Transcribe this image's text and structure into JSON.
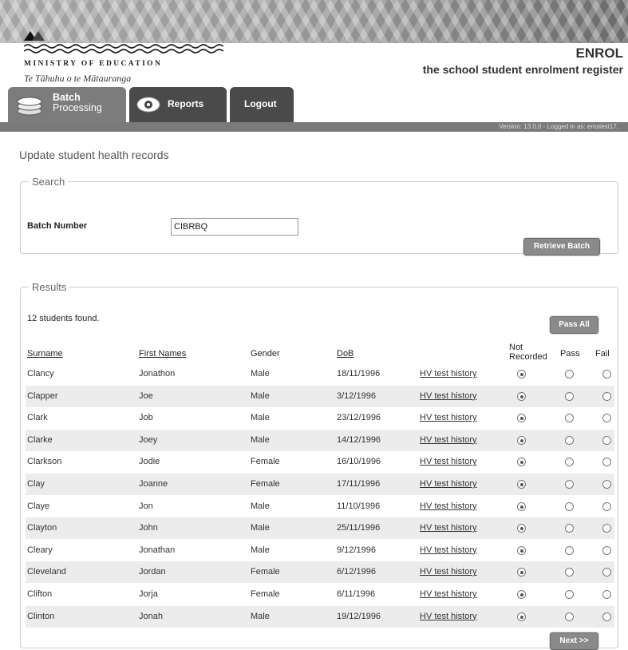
{
  "header": {
    "ministry": "MINISTRY OF EDUCATION",
    "ministry_maori": "Te Tāhuhu o te Mātauranga",
    "app_name": "ENROL",
    "app_subtitle": "the school student enrolment register",
    "version_text": "Version: 13.0.0 - Logged in as: emstest17,"
  },
  "tabs": [
    {
      "label_line1": "Batch",
      "label_line2": "Processing",
      "icon": "stack-icon",
      "active": true
    },
    {
      "label": "Reports",
      "icon": "eye-icon",
      "active": false
    },
    {
      "label": "Logout",
      "active": false
    }
  ],
  "page_title": "Update student health records",
  "search": {
    "legend": "Search",
    "batch_label": "Batch Number",
    "batch_value": "CIBRBQ",
    "retrieve_label": "Retrieve Batch"
  },
  "results": {
    "legend": "Results",
    "count_text": "12 students found.",
    "pass_all_label": "Pass All",
    "columns": {
      "surname": "Surname",
      "first_names": "First Names",
      "gender": "Gender",
      "dob": "DoB",
      "not_recorded_1": "Not",
      "not_recorded_2": "Recorded",
      "pass": "Pass",
      "fail": "Fail"
    },
    "link_text": "HV test history",
    "rows": [
      {
        "surname": "Clancy",
        "first": "Jonathon",
        "gender": "Male",
        "dob": "18/11/1996",
        "status": "not_recorded"
      },
      {
        "surname": "Clapper",
        "first": "Joe",
        "gender": "Male",
        "dob": "3/12/1996",
        "status": "not_recorded"
      },
      {
        "surname": "Clark",
        "first": "Job",
        "gender": "Male",
        "dob": "23/12/1996",
        "status": "not_recorded"
      },
      {
        "surname": "Clarke",
        "first": "Joey",
        "gender": "Male",
        "dob": "14/12/1996",
        "status": "not_recorded"
      },
      {
        "surname": "Clarkson",
        "first": "Jodie",
        "gender": "Female",
        "dob": "16/10/1996",
        "status": "not_recorded"
      },
      {
        "surname": "Clay",
        "first": "Joanne",
        "gender": "Female",
        "dob": "17/11/1996",
        "status": "not_recorded"
      },
      {
        "surname": "Claye",
        "first": "Jon",
        "gender": "Male",
        "dob": "11/10/1996",
        "status": "not_recorded"
      },
      {
        "surname": "Clayton",
        "first": "John",
        "gender": "Male",
        "dob": "25/11/1996",
        "status": "not_recorded"
      },
      {
        "surname": "Cleary",
        "first": "Jonathan",
        "gender": "Male",
        "dob": "9/12/1996",
        "status": "not_recorded"
      },
      {
        "surname": "Cleveland",
        "first": "Jordan",
        "gender": "Female",
        "dob": "6/12/1996",
        "status": "not_recorded"
      },
      {
        "surname": "Clifton",
        "first": "Jorja",
        "gender": "Female",
        "dob": "6/11/1996",
        "status": "not_recorded"
      },
      {
        "surname": "Clinton",
        "first": "Jonah",
        "gender": "Male",
        "dob": "19/12/1996",
        "status": "not_recorded"
      }
    ],
    "next_label": "Next >>"
  }
}
